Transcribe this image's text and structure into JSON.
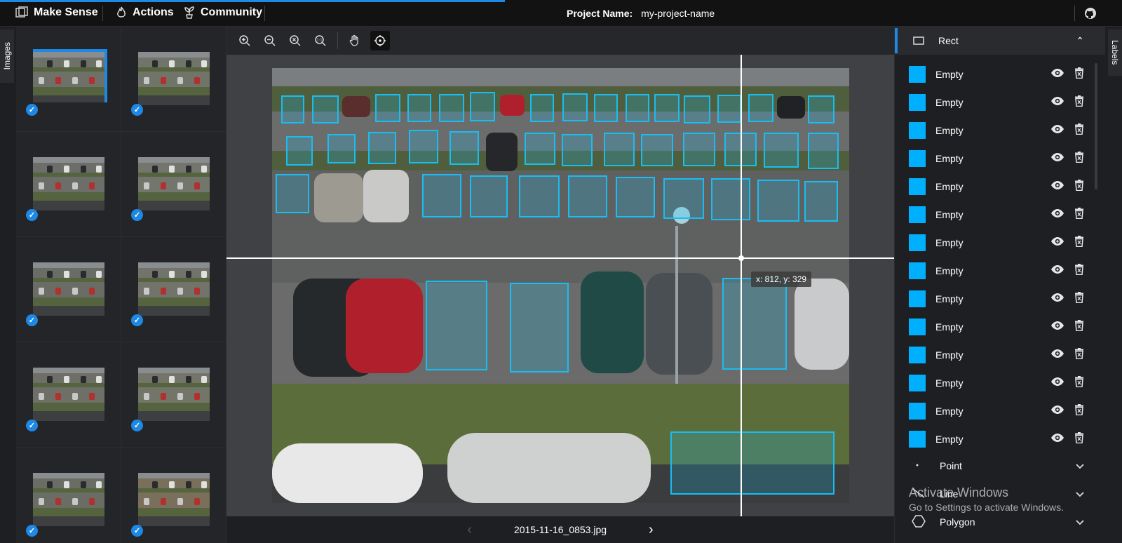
{
  "topbar": {
    "app_name": "Make Sense",
    "menu": [
      "Actions",
      "Community"
    ],
    "project_label": "Project Name:",
    "project_name": "my-project-name"
  },
  "left_tab": {
    "label": "Images"
  },
  "right_tab": {
    "label": "Labels"
  },
  "thumbnails": [
    {
      "selected": true,
      "checked": true
    },
    {
      "selected": false,
      "checked": true
    },
    {
      "selected": false,
      "checked": true
    },
    {
      "selected": false,
      "checked": true
    },
    {
      "selected": false,
      "checked": true
    },
    {
      "selected": false,
      "checked": true
    },
    {
      "selected": false,
      "checked": true
    },
    {
      "selected": false,
      "checked": true
    },
    {
      "selected": false,
      "checked": true
    },
    {
      "selected": false,
      "checked": true
    }
  ],
  "canvas": {
    "cursor_coords": "x: 812, y: 329",
    "filename": "2015-11-16_0853.jpg"
  },
  "right_panel": {
    "rect_header": "Rect",
    "labels": [
      "Empty",
      "Empty",
      "Empty",
      "Empty",
      "Empty",
      "Empty",
      "Empty",
      "Empty",
      "Empty",
      "Empty",
      "Empty",
      "Empty",
      "Empty",
      "Empty"
    ],
    "other_tools": [
      "Point",
      "Line",
      "Polygon"
    ]
  },
  "watermark": {
    "title": "Activate Windows",
    "subtitle": "Go to Settings to activate Windows."
  },
  "colors": {
    "accent": "#1e88e5",
    "bbox": "#19bdf2",
    "label_swatch": "#00b0ff"
  }
}
